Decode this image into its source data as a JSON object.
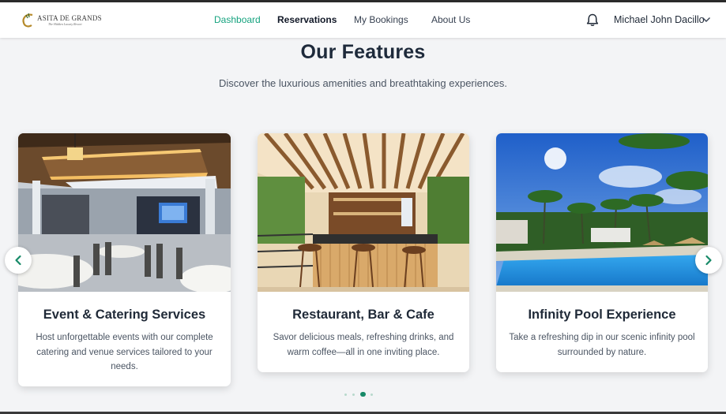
{
  "brand": {
    "name": "ASITA DE GRANDS",
    "tagline": "The Hidden Luxury Resort"
  },
  "nav": {
    "links": [
      {
        "label": "Dashboard"
      },
      {
        "label": "Reservations"
      },
      {
        "label": "My Bookings"
      },
      {
        "label": "About Us"
      }
    ],
    "user_name": "Michael John Dacillo"
  },
  "features": {
    "title": "Our Features",
    "subtitle": "Discover the luxurious amenities and breathtaking experiences.",
    "cards": [
      {
        "title": "Event & Catering Services",
        "desc_lines": [
          "Host unforgettable events with our complete",
          "catering and venue services tailored to your",
          "needs."
        ]
      },
      {
        "title": "Restaurant, Bar & Cafe",
        "desc_lines": [
          "Savor delicious meals, refreshing drinks, and",
          "warm coffee—all in one inviting place."
        ]
      },
      {
        "title": "Infinity Pool Experience",
        "desc_lines": [
          "Take a refreshing dip in our scenic infinity pool",
          "surrounded by nature."
        ]
      }
    ],
    "carousel": {
      "dot_count": 4,
      "active_index": 2
    }
  },
  "colors": {
    "accent": "#16a37f",
    "title": "#1e2a3b",
    "background": "#f3f4f6"
  },
  "icons": [
    "logo-icon",
    "bell-icon",
    "chevron-down-icon",
    "chevron-left-icon",
    "chevron-right-icon"
  ]
}
